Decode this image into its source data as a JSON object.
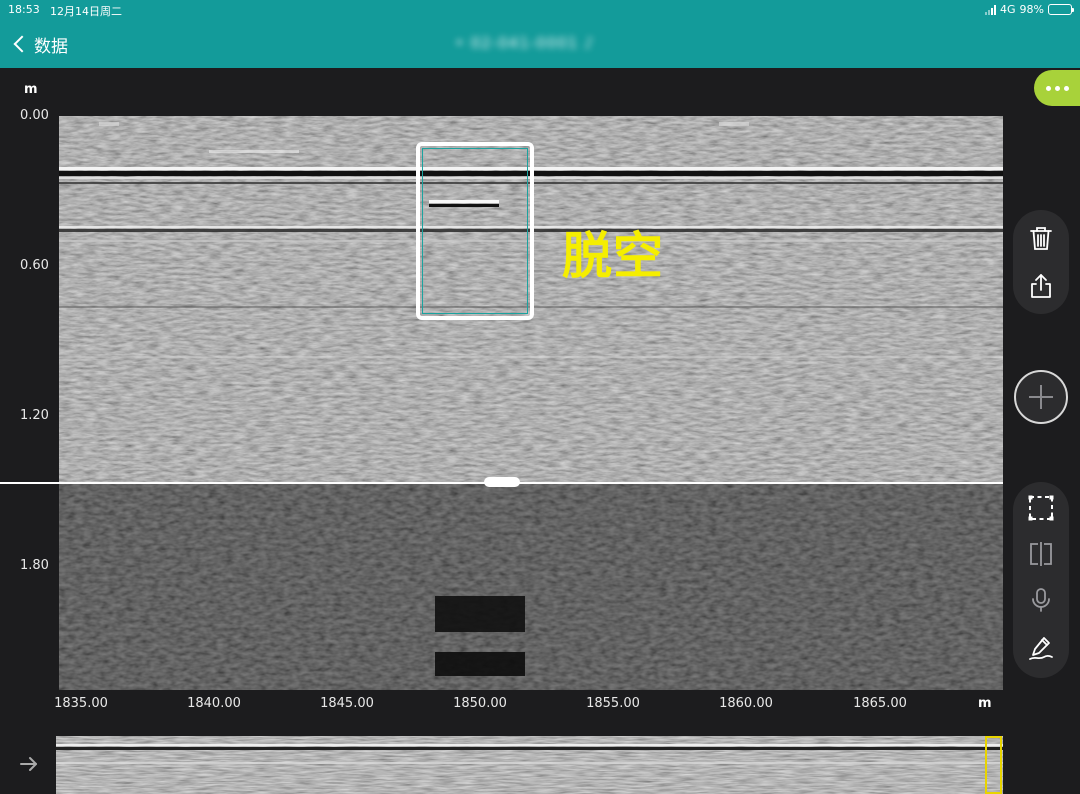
{
  "status_bar": {
    "time": "18:53",
    "date": "12月14日周二",
    "network": "4G",
    "battery": "98%",
    "battery_level": 0.98
  },
  "header": {
    "back_label": "数据",
    "file_title": "• 02-041-0001 ♪"
  },
  "y_axis": {
    "unit": "m",
    "ticks": [
      "0.00",
      "0.60",
      "1.20",
      "1.80"
    ]
  },
  "x_axis": {
    "unit": "m",
    "ticks": [
      "1835.00",
      "1840.00",
      "1845.00",
      "1850.00",
      "1855.00",
      "1860.00",
      "1865.00"
    ]
  },
  "annotation": {
    "label": "脱空",
    "color": "#f5ee00",
    "x_range_m": [
      1848.3,
      1852.2
    ],
    "depth_range_m": [
      0.12,
      0.78
    ]
  },
  "colors": {
    "header": "#139b9a",
    "accent_more": "#a8d23a",
    "overview_window": "#e8d400"
  },
  "toolbar": {
    "more": "more-dots-icon",
    "top_group": [
      "trash-icon",
      "share-icon"
    ],
    "add": "plus-icon",
    "bottom_group": [
      "select-region-icon",
      "split-view-icon",
      "microphone-icon",
      "pen-icon"
    ]
  },
  "overview": {
    "icon": "arrow-right-icon",
    "window_position": 0.98
  }
}
